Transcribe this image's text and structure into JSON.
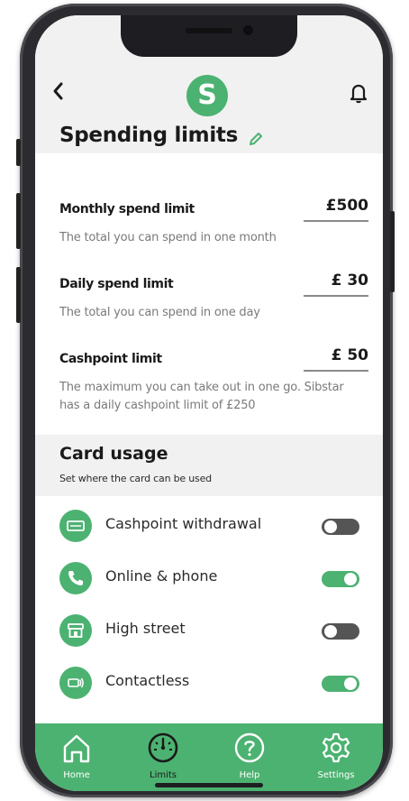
{
  "header": {
    "logo_letter": "S",
    "title": "Spending limits"
  },
  "limits": [
    {
      "label": "Monthly spend limit",
      "value": "£500",
      "description": "The total you can spend in one month"
    },
    {
      "label": "Daily spend limit",
      "value": "£ 30",
      "description": "The total you can spend in one day"
    },
    {
      "label": "Cashpoint limit",
      "value": "£ 50",
      "description": "The maximum you can take out in one go. Sibstar has a daily cashpoint limit of £250"
    }
  ],
  "card_usage": {
    "title": "Card usage",
    "subtitle": "Set where the card can be used",
    "items": [
      {
        "label": "Cashpoint withdrawal",
        "icon": "cash-icon",
        "enabled": false
      },
      {
        "label": "Online & phone",
        "icon": "phone-icon",
        "enabled": true
      },
      {
        "label": "High street",
        "icon": "shop-icon",
        "enabled": false
      },
      {
        "label": "Contactless",
        "icon": "contactless-icon",
        "enabled": true
      }
    ]
  },
  "nav": [
    {
      "label": "Home",
      "icon": "home-icon"
    },
    {
      "label": "Limits",
      "icon": "gauge-icon"
    },
    {
      "label": "Help",
      "icon": "help-icon"
    },
    {
      "label": "Settings",
      "icon": "gear-icon"
    }
  ],
  "colors": {
    "accent": "#4cb271",
    "toggle_off": "#555555"
  }
}
